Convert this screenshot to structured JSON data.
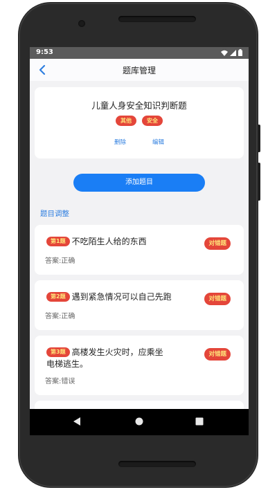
{
  "status": {
    "time": "9:53"
  },
  "nav": {
    "title": "题库管理"
  },
  "quiz": {
    "title": "儿童人身安全知识判断题",
    "tags": [
      "其他",
      "安全"
    ],
    "delete_label": "删除",
    "edit_label": "编辑"
  },
  "add_button_label": "添加题目",
  "section_label": "题目调整",
  "questions": [
    {
      "num": "第1题",
      "text": "不吃陌生人给的东西",
      "answer": "答案:正确",
      "mark": "对错题"
    },
    {
      "num": "第2题",
      "text": "遇到紧急情况可以自己先跑",
      "answer": "答案:正确",
      "mark": "对错题"
    },
    {
      "num": "第3题",
      "text": "高楼发生火灾时，应乘坐电梯逃生。",
      "answer": "答案:错误",
      "mark": "对错题"
    }
  ],
  "colors": {
    "accent": "#1a7ef5",
    "tag_bg": "#e4463a",
    "tag_text": "#ffe27a",
    "link": "#2f7fe0"
  }
}
